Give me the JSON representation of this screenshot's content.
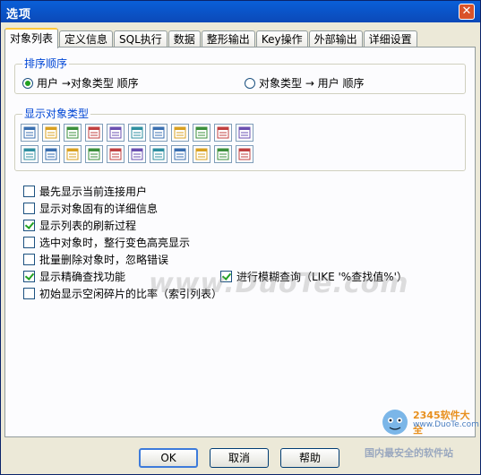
{
  "window": {
    "title": "选项"
  },
  "tabs": [
    {
      "label": "对象列表"
    },
    {
      "label": "定义信息"
    },
    {
      "label": "SQL执行"
    },
    {
      "label": "数据"
    },
    {
      "label": "整形输出"
    },
    {
      "label": "Key操作"
    },
    {
      "label": "外部输出"
    },
    {
      "label": "详细设置"
    }
  ],
  "sort_group": {
    "legend": "排序顺序",
    "options": [
      {
        "label": "用户 →对象类型 顺序",
        "selected": true
      },
      {
        "label": "对象类型 → 用户 顺序",
        "selected": false
      }
    ]
  },
  "types_group": {
    "legend": "显示对象类型",
    "icons": [
      "table-icon",
      "key-icon",
      "view-icon",
      "sequence-icon",
      "synonym-icon",
      "database-link-icon",
      "index-icon",
      "trigger-icon",
      "package-icon",
      "package-body-icon",
      "procedure-icon",
      "function-icon",
      "cluster-icon",
      "snapshot-icon",
      "directory-icon",
      "library-icon",
      "type-icon",
      "java-icon",
      "queue-icon",
      "materialized-view-icon",
      "lob-icon",
      "dimension-icon"
    ]
  },
  "options": [
    {
      "label": "最先显示当前连接用户",
      "checked": false
    },
    {
      "label": "显示对象固有的详细信息",
      "checked": false
    },
    {
      "label": "显示列表的刷新过程",
      "checked": true
    },
    {
      "label": "选中对象时，整行变色高亮显示",
      "checked": false
    },
    {
      "label": "批量删除对象时，忽略错误",
      "checked": false
    },
    {
      "label": "显示精确查找功能",
      "checked": true
    },
    {
      "label": "进行模糊查询（LIKE '%查找值%'）",
      "checked": true
    },
    {
      "label": "初始显示空闲碎片的比率（索引列表）",
      "checked": false
    }
  ],
  "watermark": {
    "text": "www.DuoTe.com",
    "logo_text": "2345软件大全",
    "logo_url": "www.DuoTe.com",
    "logo_slogan": "国内最安全的软件站"
  },
  "buttons": {
    "ok": "OK",
    "cancel": "取消",
    "help": "帮助"
  },
  "colors": {
    "accent": "#0046d5",
    "title_bar": "#0b49b8",
    "check": "#21a121"
  }
}
